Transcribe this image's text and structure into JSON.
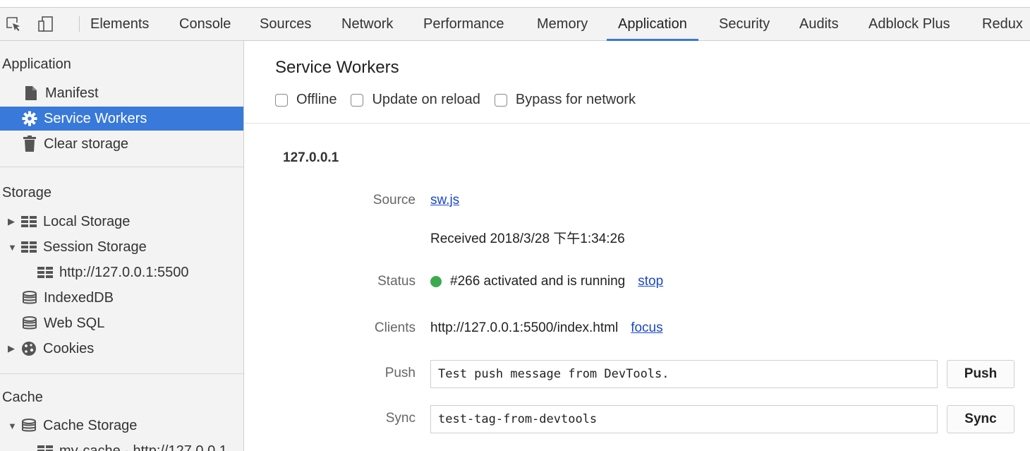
{
  "tabs": [
    {
      "label": "Elements"
    },
    {
      "label": "Console"
    },
    {
      "label": "Sources"
    },
    {
      "label": "Network"
    },
    {
      "label": "Performance"
    },
    {
      "label": "Memory"
    },
    {
      "label": "Application",
      "active": true
    },
    {
      "label": "Security"
    },
    {
      "label": "Audits"
    },
    {
      "label": "Adblock Plus"
    },
    {
      "label": "Redux"
    }
  ],
  "sidebar": {
    "application": {
      "title": "Application",
      "items": [
        {
          "label": "Manifest",
          "icon": "document-icon"
        },
        {
          "label": "Service Workers",
          "icon": "gear-icon",
          "selected": true
        },
        {
          "label": "Clear storage",
          "icon": "trash-icon"
        }
      ]
    },
    "storage": {
      "title": "Storage",
      "items": [
        {
          "label": "Local Storage",
          "icon": "grid-icon",
          "arrow": "▶"
        },
        {
          "label": "Session Storage",
          "icon": "grid-icon",
          "arrow": "▼"
        },
        {
          "label": "http://127.0.0.1:5500",
          "icon": "grid-icon"
        },
        {
          "label": "IndexedDB",
          "icon": "database-icon"
        },
        {
          "label": "Web SQL",
          "icon": "database-icon"
        },
        {
          "label": "Cookies",
          "icon": "cookie-icon",
          "arrow": "▶"
        }
      ]
    },
    "cache": {
      "title": "Cache",
      "items": [
        {
          "label": "Cache Storage",
          "icon": "database-icon",
          "arrow": "▼"
        },
        {
          "label": "my-cache - http://127.0.0.1",
          "icon": "grid-icon"
        }
      ]
    }
  },
  "main": {
    "title": "Service Workers",
    "options": [
      {
        "label": "Offline",
        "checked": false
      },
      {
        "label": "Update on reload",
        "checked": false
      },
      {
        "label": "Bypass for network",
        "checked": false
      }
    ],
    "origin": "127.0.0.1",
    "source_label": "Source",
    "source_link": "sw.js",
    "received": "Received 2018/3/28 下午1:34:26",
    "status_label": "Status",
    "status_text": "#266 activated and is running",
    "status_color": "#3cab4f",
    "stop_link": "stop",
    "clients_label": "Clients",
    "clients_url": "http://127.0.0.1:5500/index.html",
    "focus_link": "focus",
    "push_label": "Push",
    "push_value": "Test push message from DevTools.",
    "push_button": "Push",
    "sync_label": "Sync",
    "sync_value": "test-tag-from-devtools",
    "sync_button": "Sync"
  },
  "colors": {
    "accent": "#3879d9",
    "link": "#1a47c9"
  }
}
